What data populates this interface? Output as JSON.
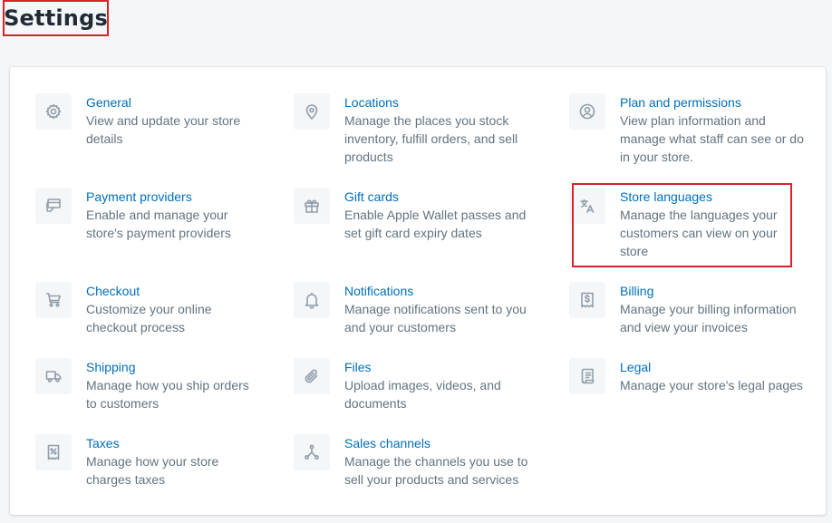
{
  "page": {
    "title": "Settings"
  },
  "colors": {
    "link": "#006fbb",
    "text": "#637381",
    "icon": "#919eab",
    "highlight": "#d8232a"
  },
  "items": [
    {
      "id": "general",
      "icon": "gear-icon",
      "title": "General",
      "desc": [
        "View and update your store",
        "details"
      ]
    },
    {
      "id": "locations",
      "icon": "location-pin-icon",
      "title": "Locations",
      "desc": [
        "Manage the places you stock",
        "inventory, fulfill orders, and sell",
        "products"
      ]
    },
    {
      "id": "plan-permissions",
      "icon": "user-circle-icon",
      "title": "Plan and permissions",
      "desc": [
        "View plan information and",
        "manage what staff can see or do",
        "in your store."
      ]
    },
    {
      "id": "payment-providers",
      "icon": "credit-card-icon",
      "title": "Payment providers",
      "desc": [
        "Enable and manage your",
        "store's payment providers"
      ]
    },
    {
      "id": "gift-cards",
      "icon": "gift-icon",
      "title": "Gift cards",
      "desc": [
        "Enable Apple Wallet passes and",
        "set gift card expiry dates"
      ]
    },
    {
      "id": "store-languages",
      "icon": "translate-icon",
      "title": "Store languages",
      "desc": [
        "Manage the languages your",
        "customers can view on your",
        "store"
      ]
    },
    {
      "id": "checkout",
      "icon": "cart-icon",
      "title": "Checkout",
      "desc": [
        "Customize your online",
        "checkout process"
      ]
    },
    {
      "id": "notifications",
      "icon": "bell-icon",
      "title": "Notifications",
      "desc": [
        "Manage notifications sent to you",
        "and your customers"
      ]
    },
    {
      "id": "billing",
      "icon": "receipt-dollar-icon",
      "title": "Billing",
      "desc": [
        "Manage your billing information",
        "and view your invoices"
      ]
    },
    {
      "id": "shipping",
      "icon": "truck-icon",
      "title": "Shipping",
      "desc": [
        "Manage how you ship orders",
        "to customers"
      ]
    },
    {
      "id": "files",
      "icon": "paperclip-icon",
      "title": "Files",
      "desc": [
        "Upload images, videos, and",
        "documents"
      ]
    },
    {
      "id": "legal",
      "icon": "legal-document-icon",
      "title": "Legal",
      "desc": [
        "Manage your store's legal pages"
      ]
    },
    {
      "id": "taxes",
      "icon": "tax-receipt-icon",
      "title": "Taxes",
      "desc": [
        "Manage how your store",
        "charges taxes"
      ]
    },
    {
      "id": "sales-channels",
      "icon": "channels-icon",
      "title": "Sales channels",
      "desc": [
        "Manage the channels you use to",
        "sell your products and services"
      ]
    }
  ]
}
